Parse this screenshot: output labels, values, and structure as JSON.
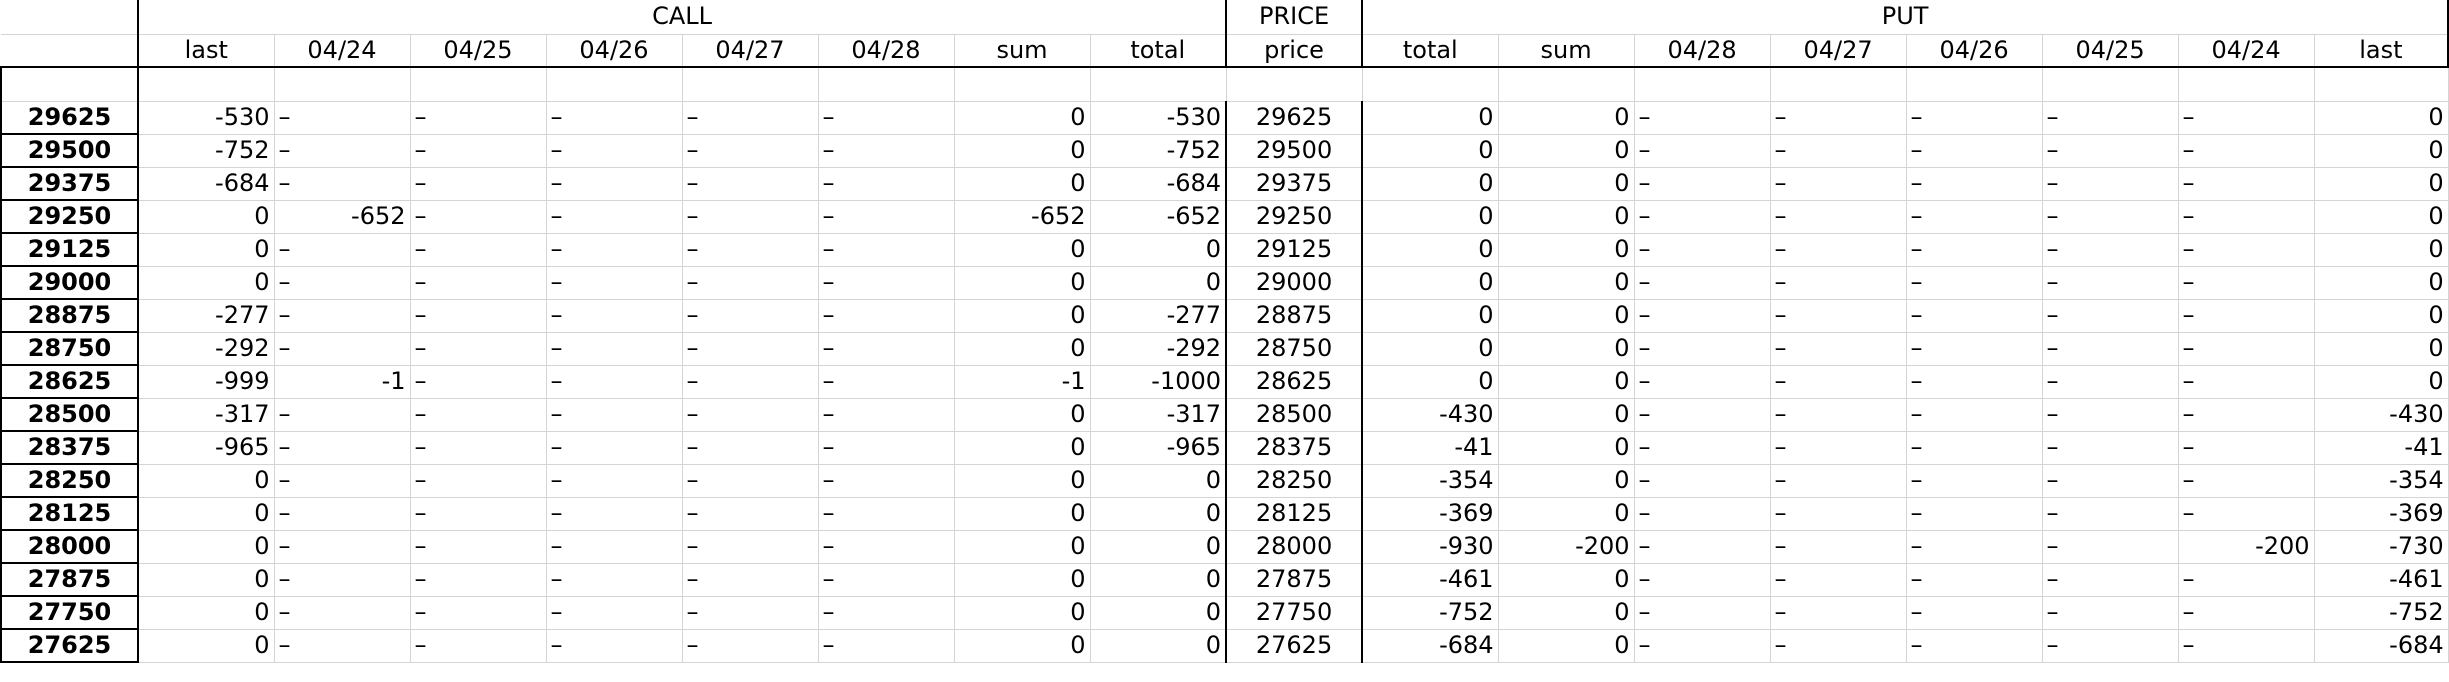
{
  "headers": {
    "call": "CALL",
    "price": "PRICE",
    "put": "PUT"
  },
  "subheaders": {
    "call": [
      "last",
      "04/24",
      "04/25",
      "04/26",
      "04/27",
      "04/28",
      "sum",
      "total"
    ],
    "price": "price",
    "put": [
      "total",
      "sum",
      "04/28",
      "04/27",
      "04/26",
      "04/25",
      "04/24",
      "last"
    ]
  },
  "rows": [
    {
      "strike": "29625",
      "call": [
        "-530",
        "–",
        "–",
        "–",
        "–",
        "–",
        "0",
        "-530"
      ],
      "price": "29625",
      "put": [
        "0",
        "0",
        "–",
        "–",
        "–",
        "–",
        "–",
        "0"
      ]
    },
    {
      "strike": "29500",
      "call": [
        "-752",
        "–",
        "–",
        "–",
        "–",
        "–",
        "0",
        "-752"
      ],
      "price": "29500",
      "put": [
        "0",
        "0",
        "–",
        "–",
        "–",
        "–",
        "–",
        "0"
      ]
    },
    {
      "strike": "29375",
      "call": [
        "-684",
        "–",
        "–",
        "–",
        "–",
        "–",
        "0",
        "-684"
      ],
      "price": "29375",
      "put": [
        "0",
        "0",
        "–",
        "–",
        "–",
        "–",
        "–",
        "0"
      ]
    },
    {
      "strike": "29250",
      "call": [
        "0",
        "-652",
        "–",
        "–",
        "–",
        "–",
        "-652",
        "-652"
      ],
      "price": "29250",
      "put": [
        "0",
        "0",
        "–",
        "–",
        "–",
        "–",
        "–",
        "0"
      ]
    },
    {
      "strike": "29125",
      "call": [
        "0",
        "–",
        "–",
        "–",
        "–",
        "–",
        "0",
        "0"
      ],
      "price": "29125",
      "put": [
        "0",
        "0",
        "–",
        "–",
        "–",
        "–",
        "–",
        "0"
      ]
    },
    {
      "strike": "29000",
      "call": [
        "0",
        "–",
        "–",
        "–",
        "–",
        "–",
        "0",
        "0"
      ],
      "price": "29000",
      "put": [
        "0",
        "0",
        "–",
        "–",
        "–",
        "–",
        "–",
        "0"
      ]
    },
    {
      "strike": "28875",
      "call": [
        "-277",
        "–",
        "–",
        "–",
        "–",
        "–",
        "0",
        "-277"
      ],
      "price": "28875",
      "put": [
        "0",
        "0",
        "–",
        "–",
        "–",
        "–",
        "–",
        "0"
      ]
    },
    {
      "strike": "28750",
      "call": [
        "-292",
        "–",
        "–",
        "–",
        "–",
        "–",
        "0",
        "-292"
      ],
      "price": "28750",
      "put": [
        "0",
        "0",
        "–",
        "–",
        "–",
        "–",
        "–",
        "0"
      ]
    },
    {
      "strike": "28625",
      "call": [
        "-999",
        "-1",
        "–",
        "–",
        "–",
        "–",
        "-1",
        "-1000"
      ],
      "price": "28625",
      "put": [
        "0",
        "0",
        "–",
        "–",
        "–",
        "–",
        "–",
        "0"
      ]
    },
    {
      "strike": "28500",
      "call": [
        "-317",
        "–",
        "–",
        "–",
        "–",
        "–",
        "0",
        "-317"
      ],
      "price": "28500",
      "put": [
        "-430",
        "0",
        "–",
        "–",
        "–",
        "–",
        "–",
        "-430"
      ]
    },
    {
      "strike": "28375",
      "call": [
        "-965",
        "–",
        "–",
        "–",
        "–",
        "–",
        "0",
        "-965"
      ],
      "price": "28375",
      "put": [
        "-41",
        "0",
        "–",
        "–",
        "–",
        "–",
        "–",
        "-41"
      ]
    },
    {
      "strike": "28250",
      "call": [
        "0",
        "–",
        "–",
        "–",
        "–",
        "–",
        "0",
        "0"
      ],
      "price": "28250",
      "put": [
        "-354",
        "0",
        "–",
        "–",
        "–",
        "–",
        "–",
        "-354"
      ]
    },
    {
      "strike": "28125",
      "call": [
        "0",
        "–",
        "–",
        "–",
        "–",
        "–",
        "0",
        "0"
      ],
      "price": "28125",
      "put": [
        "-369",
        "0",
        "–",
        "–",
        "–",
        "–",
        "–",
        "-369"
      ]
    },
    {
      "strike": "28000",
      "call": [
        "0",
        "–",
        "–",
        "–",
        "–",
        "–",
        "0",
        "0"
      ],
      "price": "28000",
      "put": [
        "-930",
        "-200",
        "–",
        "–",
        "–",
        "–",
        "-200",
        "-730"
      ]
    },
    {
      "strike": "27875",
      "call": [
        "0",
        "–",
        "–",
        "–",
        "–",
        "–",
        "0",
        "0"
      ],
      "price": "27875",
      "put": [
        "-461",
        "0",
        "–",
        "–",
        "–",
        "–",
        "–",
        "-461"
      ]
    },
    {
      "strike": "27750",
      "call": [
        "0",
        "–",
        "–",
        "–",
        "–",
        "–",
        "0",
        "0"
      ],
      "price": "27750",
      "put": [
        "-752",
        "0",
        "–",
        "–",
        "–",
        "–",
        "–",
        "-752"
      ]
    },
    {
      "strike": "27625",
      "call": [
        "0",
        "–",
        "–",
        "–",
        "–",
        "–",
        "0",
        "0"
      ],
      "price": "27625",
      "put": [
        "-684",
        "0",
        "–",
        "–",
        "–",
        "–",
        "–",
        "-684"
      ]
    }
  ]
}
